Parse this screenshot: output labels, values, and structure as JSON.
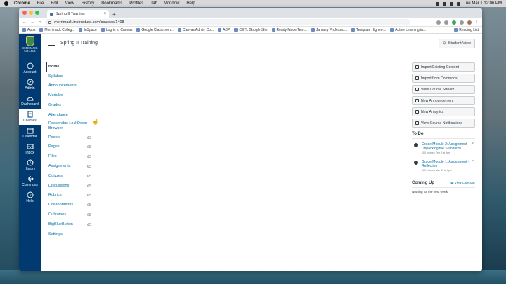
{
  "menubar": {
    "app": "Chrome",
    "items": [
      "File",
      "Edit",
      "View",
      "History",
      "Bookmarks",
      "Profiles",
      "Tab",
      "Window",
      "Help"
    ],
    "clock": "Tue Mar 1  12:06 PM"
  },
  "browser": {
    "tab_title": "Spring II Training",
    "url": "merrimack.instructure.com/courses/1408",
    "bookmarks": [
      "Apps",
      "Merrimack Colleg...",
      "InSpace",
      "Log in to Canvas",
      "Google Classroom...",
      "Canvas Admin Co...",
      "ADP",
      "CETL Google Site",
      "Ready Made Tem...",
      "January Professio...",
      "Template Higher-...",
      "Active Learning in..."
    ],
    "reading_list": "Reading List"
  },
  "global_nav": {
    "logo_text": "MERRIMACK COLLEGE",
    "items": [
      {
        "label": "Account",
        "icon": "account-icon"
      },
      {
        "label": "Admin",
        "icon": "admin-icon"
      },
      {
        "label": "Dashboard",
        "icon": "dashboard-icon"
      },
      {
        "label": "Courses",
        "icon": "courses-icon"
      },
      {
        "label": "Calendar",
        "icon": "calendar-icon"
      },
      {
        "label": "Inbox",
        "icon": "inbox-icon"
      },
      {
        "label": "History",
        "icon": "history-icon"
      },
      {
        "label": "Commons",
        "icon": "commons-icon"
      },
      {
        "label": "Help",
        "icon": "help-icon"
      }
    ]
  },
  "header": {
    "course_title": "Spring II Training",
    "student_view": "Student View"
  },
  "course_nav": [
    "Home",
    "Syllabus",
    "Announcements",
    "Modules",
    "Grades",
    "Attendance",
    "Respondus LockDown Browser",
    "People",
    "Pages",
    "Files",
    "Assignments",
    "Quizzes",
    "Discussions",
    "Rubrics",
    "Collaborations",
    "Outcomes",
    "BigBlueButton",
    "Settings"
  ],
  "sidebar": {
    "buttons": [
      "Import Existing Content",
      "Import from Commons",
      "View Course Stream",
      "New Announcement",
      "New Analytics",
      "View Course Notifications"
    ],
    "todo_title": "To Do",
    "todos": [
      {
        "title": "Grade Module 2: Assignment - Unpacking the Standards",
        "meta": "100 points • Feb 8 at 3pm"
      },
      {
        "title": "Grade Module 1: Assignment - Reflection",
        "meta": "100 points • Mar 31 at 3pm"
      }
    ],
    "coming_up": "Coming Up",
    "view_calendar": "View Calendar",
    "nothing": "Nothing for the next week"
  },
  "colors": {
    "nav_bg": "#003a70",
    "link": "#0770a3",
    "text": "#2d3b45"
  }
}
